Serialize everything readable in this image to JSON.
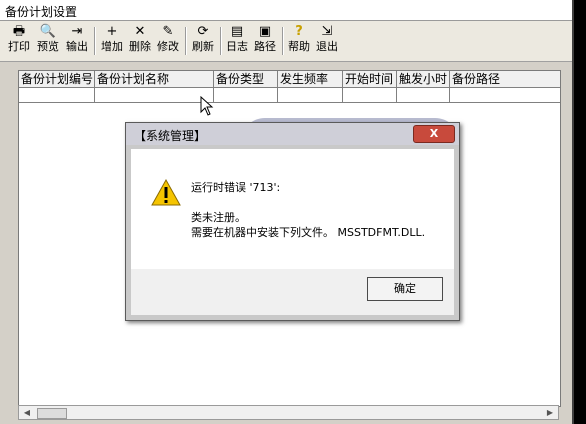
{
  "window": {
    "title": "备份计划设置"
  },
  "toolbar": {
    "buttons": [
      {
        "label": "打印",
        "icon": "printer-icon",
        "glyph": "🖶"
      },
      {
        "label": "预览",
        "icon": "preview-icon",
        "glyph": "🔍"
      },
      {
        "label": "输出",
        "icon": "export-icon",
        "glyph": "⇥"
      },
      {
        "label": "增加",
        "icon": "add-icon",
        "glyph": "+"
      },
      {
        "label": "删除",
        "icon": "delete-icon",
        "glyph": "✕"
      },
      {
        "label": "修改",
        "icon": "edit-icon",
        "glyph": "✎"
      },
      {
        "label": "刷新",
        "icon": "refresh-icon",
        "glyph": "⟳"
      },
      {
        "label": "日志",
        "icon": "log-icon",
        "glyph": "▤"
      },
      {
        "label": "路径",
        "icon": "save-path-icon",
        "glyph": "▣"
      },
      {
        "label": "帮助",
        "icon": "help-icon",
        "glyph": "?"
      },
      {
        "label": "退出",
        "icon": "exit-icon",
        "glyph": "⇲"
      }
    ]
  },
  "grid": {
    "columns": [
      "备份计划编号",
      "备份计划名称",
      "备份类型",
      "发生频率",
      "开始时间",
      "触发小时",
      "备份路径"
    ]
  },
  "dialog": {
    "title": "【系统管理】",
    "close_label": "X",
    "line1": "运行时错误 '713':",
    "line2": "类未注册。",
    "line3": "需要在机器中安装下列文件。 MSSTDFMT.DLL.",
    "ok_label": "确定"
  }
}
